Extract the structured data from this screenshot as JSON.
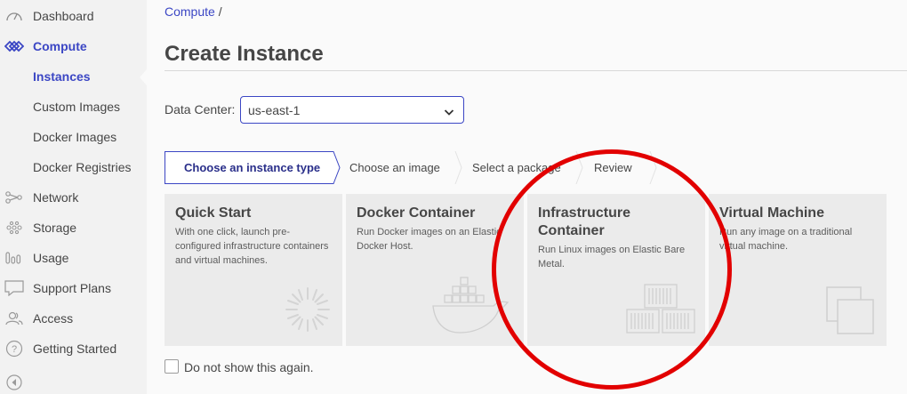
{
  "sidebar": {
    "items": [
      {
        "label": "Dashboard",
        "icon": "gauge-icon"
      },
      {
        "label": "Compute",
        "icon": "compute-icon"
      },
      {
        "label": "Instances"
      },
      {
        "label": "Custom Images"
      },
      {
        "label": "Docker Images"
      },
      {
        "label": "Docker Registries"
      },
      {
        "label": "Network",
        "icon": "network-icon"
      },
      {
        "label": "Storage",
        "icon": "storage-icon"
      },
      {
        "label": "Usage",
        "icon": "usage-icon"
      },
      {
        "label": "Support Plans",
        "icon": "support-icon"
      },
      {
        "label": "Access",
        "icon": "access-icon"
      },
      {
        "label": "Getting Started",
        "icon": "help-icon"
      }
    ],
    "collapse_icon": "collapse-icon"
  },
  "breadcrumb": {
    "root": "Compute",
    "separator": "/"
  },
  "page": {
    "title": "Create Instance"
  },
  "data_center": {
    "label": "Data Center:",
    "value": "us-east-1"
  },
  "stepper": {
    "steps": [
      "Choose an instance type",
      "Choose an image",
      "Select a package",
      "Review"
    ]
  },
  "cards": [
    {
      "title": "Quick Start",
      "desc": "With one click, launch pre-configured infrastructure containers and virtual machines.",
      "icon": "loading-burst-icon"
    },
    {
      "title": "Docker Container",
      "desc": "Run Docker images on an Elastic Docker Host.",
      "icon": "docker-whale-icon"
    },
    {
      "title": "Infrastructure Container",
      "desc": "Run Linux images on Elastic Bare Metal.",
      "icon": "shipping-containers-icon"
    },
    {
      "title": "Virtual Machine",
      "desc": "Run any image on a traditional virtual machine.",
      "icon": "stacked-windows-icon"
    }
  ],
  "dont_show": {
    "label": "Do not show this again."
  },
  "colors": {
    "accent": "#3b46c4",
    "annotation": "#e20000"
  }
}
